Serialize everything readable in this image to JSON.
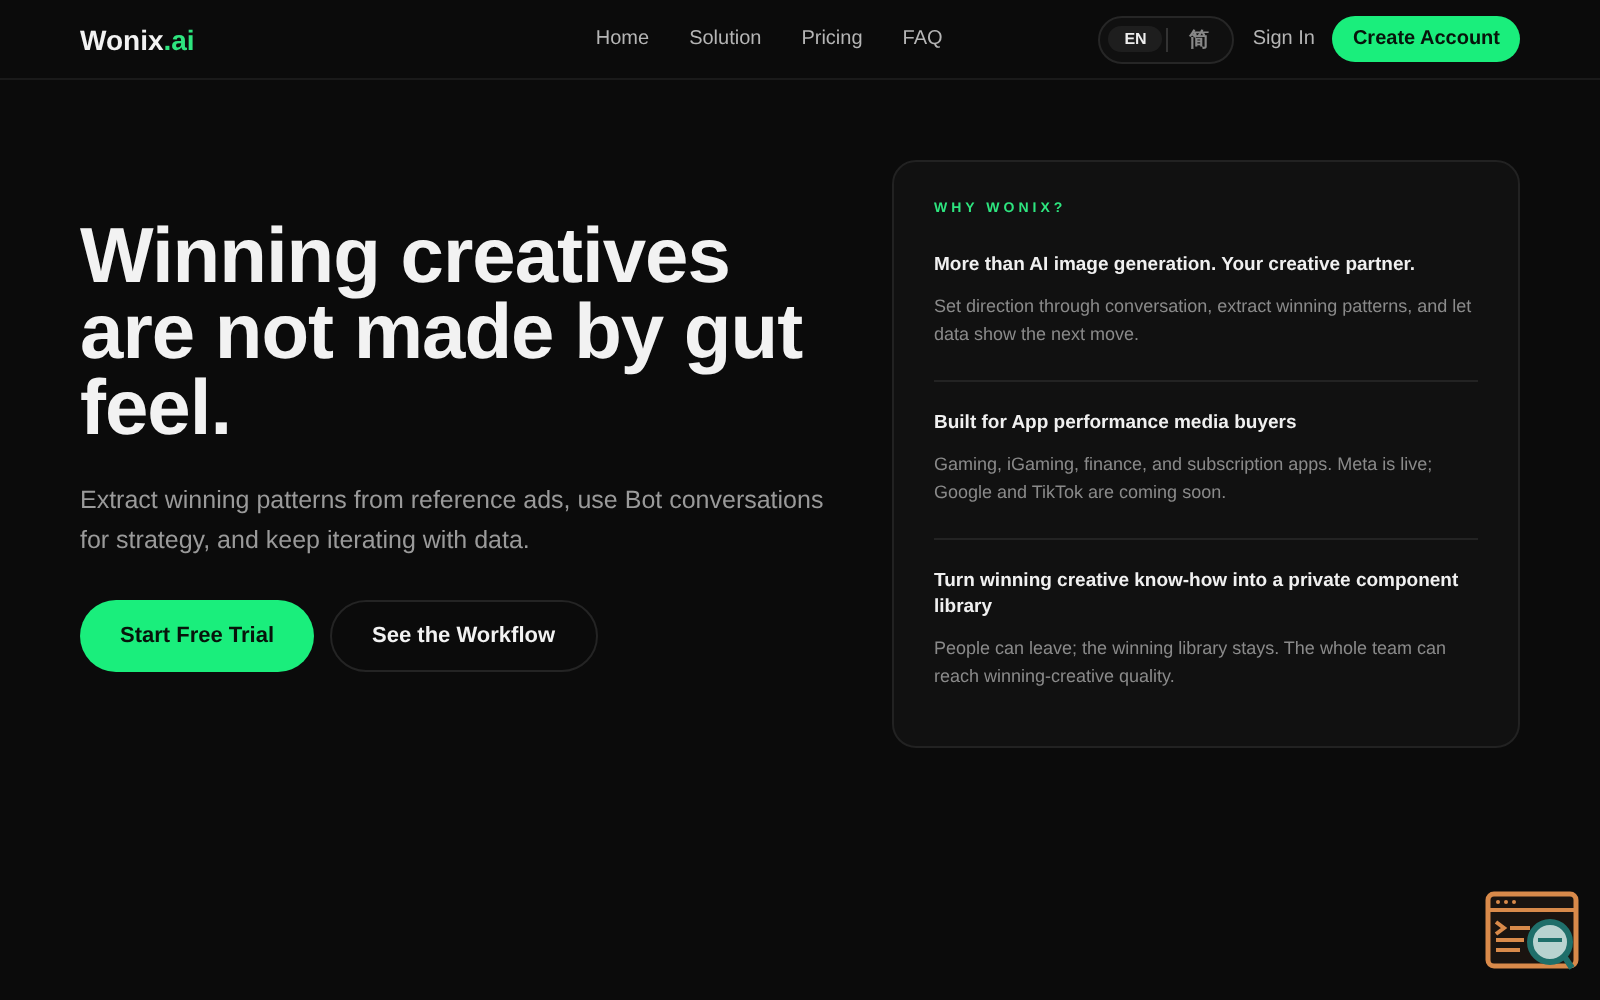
{
  "brand": {
    "name": "Wonix",
    "suffix": ".ai"
  },
  "nav": [
    "Home",
    "Solution",
    "Pricing",
    "FAQ"
  ],
  "languages": [
    {
      "label": "EN",
      "selected": true
    },
    {
      "label": "简",
      "selected": false
    }
  ],
  "sign_in": "Sign In",
  "create_account": "Create Account",
  "hero": {
    "title": "Winning creatives are not made by gut feel.",
    "subtitle": "Extract winning patterns from reference ads, use Bot conversations for strategy, and keep iterating with data.",
    "primary": "Start Free Trial",
    "secondary": "See the Workflow"
  },
  "why": {
    "eyebrow": "WHY WONIX?",
    "items": [
      {
        "title": "More than AI image generation. Your creative partner.",
        "text": "Set direction through conversation, extract winning patterns, and let data show the next move."
      },
      {
        "title": "Built for App performance media buyers",
        "text": "Gaming, iGaming, finance, and subscription apps. Meta is live; Google and TikTok are coming soon."
      },
      {
        "title": "Turn winning creative know-how into a private component library",
        "text": "People can leave; the winning library stays. The whole team can reach winning-creative quality."
      }
    ]
  }
}
